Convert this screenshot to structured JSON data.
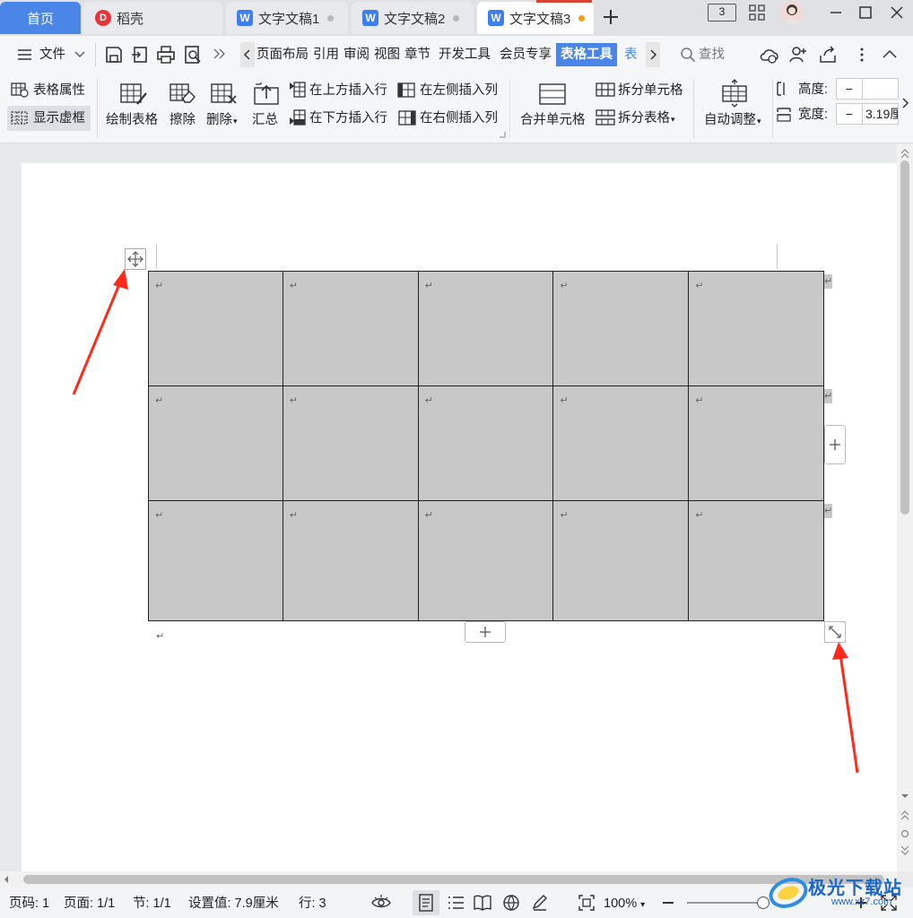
{
  "tabs": {
    "home": "首页",
    "daoke": "稻壳",
    "doc1": "文字文稿1",
    "doc2": "文字文稿2",
    "doc3": "文字文稿3"
  },
  "window": {
    "page_count_badge": "3"
  },
  "menu": {
    "file": "文件",
    "items": [
      "页面布局",
      "引用",
      "审阅",
      "视图",
      "章节",
      "开发工具",
      "会员专享",
      "表格工具",
      "表格"
    ],
    "active": "表格工具",
    "search": "查找"
  },
  "ribbon": {
    "table_props": "表格属性",
    "show_gridlines": "显示虚框",
    "draw_table": "绘制表格",
    "erase": "擦除",
    "delete": "删除",
    "summary": "汇总",
    "insert_row_above": "在上方插入行",
    "insert_row_below": "在下方插入行",
    "insert_col_left": "在左侧插入列",
    "insert_col_right": "在右侧插入列",
    "merge_cells": "合并单元格",
    "split_cells": "拆分单元格",
    "split_table": "拆分表格",
    "auto_fit": "自动调整",
    "height_label": "高度:",
    "height_value": "",
    "width_label": "宽度:",
    "width_value": "3.19厘",
    "minus": "−"
  },
  "table": {
    "rows": 3,
    "cols": 5,
    "para_mark": "↵",
    "fill_color": "#c8c8c8"
  },
  "status": {
    "page_no": "页码: 1",
    "pages": "页面: 1/1",
    "section": "节: 1/1",
    "setting": "设置值: 7.9厘米",
    "line": "行: 3",
    "zoom": "100%",
    "zoom_level": 1.0
  },
  "watermark": {
    "text": "极光下载站",
    "url": "www.xz7.com"
  },
  "colors": {
    "accent": "#4a86e8",
    "active_tab_bg": "#ffffff",
    "modified_dot": "#f39c12",
    "arrow": "#ff2a1a"
  }
}
